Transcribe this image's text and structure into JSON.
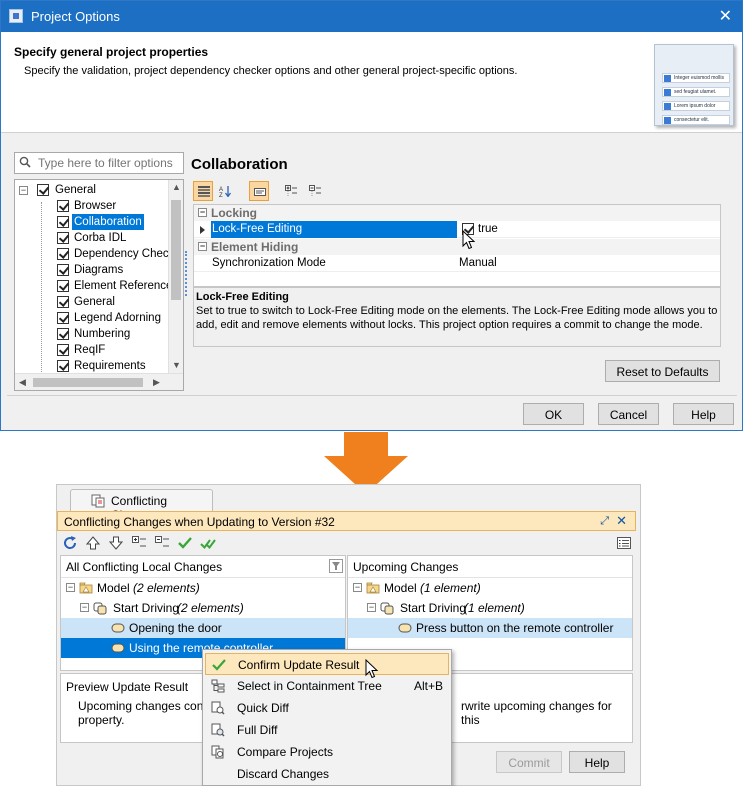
{
  "dialog": {
    "title": "Project Options",
    "header_title": "Specify general project properties",
    "header_desc": "Specify the validation, project dependency checker options and other general project-specific options.",
    "illustration_rows": [
      "Integer euismod mollis",
      "sed feugiat ulamet.",
      "Lorem ipsum dolor",
      "consectetur elit."
    ],
    "filter_placeholder": "Type here to filter options",
    "tree": {
      "root": "General",
      "items": [
        "Browser",
        "Collaboration",
        "Corba IDL",
        "Dependency Checker",
        "Diagrams",
        "Element References",
        "General",
        "Legend Adorning",
        "Numbering",
        "ReqIF",
        "Requirements"
      ],
      "selected": "Collaboration"
    },
    "panel_title": "Collaboration",
    "categories": {
      "locking": "Locking",
      "element_hiding": "Element Hiding"
    },
    "properties": {
      "lock_free_name": "Lock-Free Editing",
      "lock_free_value": "true",
      "sync_name": "Synchronization Mode",
      "sync_value": "Manual"
    },
    "description": {
      "title": "Lock-Free Editing",
      "text": "Set to true to switch to Lock-Free Editing mode on the elements. The Lock-Free Editing mode allows you to add, edit and remove elements without locks. This project option requires a commit to change the mode."
    },
    "reset_label": "Reset to Defaults",
    "ok_label": "OK",
    "cancel_label": "Cancel",
    "help_label": "Help"
  },
  "conflicts": {
    "tab_label": "Conflicting Changes",
    "bar_title": "Conflicting Changes when Updating to Version #32",
    "left_header": "All Conflicting Local Changes",
    "right_header": "Upcoming Changes",
    "left": {
      "model": "Model",
      "model_count": "(2 elements)",
      "start": "Start Driving",
      "start_count": "(2 elements)",
      "item1": "Opening the door",
      "item2": "Using the remote controller"
    },
    "right": {
      "model": "Model",
      "model_count": "(1 element)",
      "start": "Start Driving",
      "start_count": "(1 element)",
      "item1": "Press button on the remote controller"
    },
    "preview_title": "Preview Update Result",
    "preview_left": "Upcoming changes contain",
    "preview_right": "rwrite upcoming changes for this",
    "preview_line2": "property.",
    "commit_label": "Commit",
    "help_label": "Help",
    "menu": [
      {
        "label": "Confirm Update Result",
        "shortcut": ""
      },
      {
        "label": "Select in Containment Tree",
        "shortcut": "Alt+B"
      },
      {
        "label": "Quick Diff",
        "shortcut": ""
      },
      {
        "label": "Full Diff",
        "shortcut": ""
      },
      {
        "label": "Compare Projects",
        "shortcut": ""
      },
      {
        "label": "Discard Changes",
        "shortcut": ""
      }
    ]
  },
  "colors": {
    "titlebar": "#1c6fc2",
    "selection": "#0078d7",
    "arrow": "#f07f1d",
    "highlight": "#fde7bd"
  }
}
